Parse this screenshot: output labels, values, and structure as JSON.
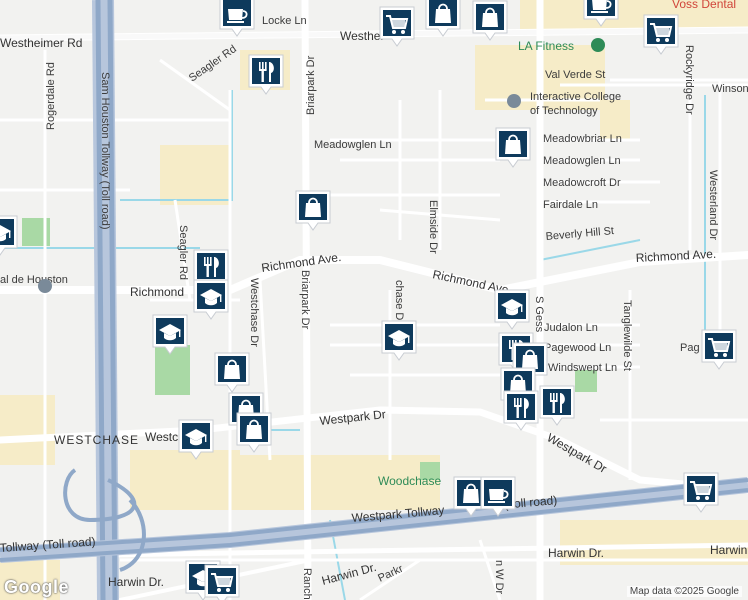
{
  "roads": {
    "locke": "Locke Ln",
    "westheimer_left": "Westheimer Rd",
    "westheimer_right": "Westhei",
    "rogerdale": "Rogerdale Rd",
    "seagler_top": "Seagler Rd",
    "seagler_left": "Seagler Rd",
    "sam_houston": "Sam Houston Tollway (Toll road)",
    "briarpark_top": "Briarpark Dr",
    "briarpark_bottom": "Briarpark Dr",
    "meadowglen_left": "Meadowglen Ln",
    "meadowbriar": "Meadowbriar Ln",
    "meadowglen_right": "Meadowglen Ln",
    "meadowcroft": "Meadowcroft Dr",
    "fairdale": "Fairdale Ln",
    "elmside": "Elmside Dr",
    "beverly_hill": "Beverly Hill St",
    "richmond_left": "Richmond Ave.",
    "richmond_mid": "Richmond Ave",
    "richmond_right": "Richmond Ave.",
    "richmond_far_left": "Richmond",
    "val_verde": "Val Verde St",
    "winsor": "Winson",
    "rockyridge": "Rockyridge Dr",
    "westerland": "Westerland Dr",
    "westchase_dr": "Westchase Dr",
    "westchase_dr2": "chase Dr",
    "judalon": "Judalon Ln",
    "pagewood": "Pagewood Ln",
    "pagewood2": "Pag",
    "windswept": "Windswept Ln",
    "tanglewilde": "Tanglewilde St",
    "s_gessner": "S Gess",
    "westpark_left": "Westpark Dr",
    "westpark_right": "Westpark Dr",
    "westchase_area": "WESTCHASE",
    "westchase_area2": "Westc",
    "westpark_tollway": "Westpark Tollway",
    "westpark_tollway_suffix": "(Toll road)",
    "tollway_left": "Tollway (Toll road)",
    "harwin_left": "Harwin Dr.",
    "harwin_mid": "Harwin Dr.",
    "harwin_right": "Harwin Dr.",
    "harwin_far_right": "Harwin",
    "ranch": "Ranch",
    "parkr": "Parkr",
    "n_w_dr": "n W Dr",
    "de_houston": "al de\nHouston"
  },
  "pois": {
    "la_fitness": "LA Fitness",
    "interactive_college": "Interactive College",
    "interactive_college_2": "of Technology",
    "woodchase": "Woodchase",
    "voss_dental": "Voss Dental"
  },
  "footer": {
    "logo": "Google",
    "credit": "Map data ©2025 Google"
  },
  "colors": {
    "marker_fill": "#ffffff",
    "marker_icon": "#0e3a5c",
    "highway": "#8fa8c8",
    "freeway_light": "#b7c6dc",
    "water": "#9ad8e8",
    "park": "#a9d9a5",
    "commercial": "#f6ecc8"
  },
  "markers": [
    {
      "type": "cafe-icon"
    },
    {
      "type": "cart-icon"
    },
    {
      "type": "shopping-bag-icon"
    },
    {
      "type": "shopping-bag-icon"
    },
    {
      "type": "cafe-icon"
    },
    {
      "type": "cart-icon"
    },
    {
      "type": "restaurant-icon"
    },
    {
      "type": "shopping-bag-icon"
    },
    {
      "type": "shopping-bag-icon"
    },
    {
      "type": "school-icon"
    },
    {
      "type": "restaurant-icon"
    },
    {
      "type": "school-icon"
    },
    {
      "type": "school-icon"
    },
    {
      "type": "school-icon"
    },
    {
      "type": "school-icon"
    },
    {
      "type": "cart-icon"
    },
    {
      "type": "restaurant-icon"
    },
    {
      "type": "shopping-bag-icon"
    },
    {
      "type": "shopping-bag-icon"
    },
    {
      "type": "shopping-bag-icon"
    },
    {
      "type": "restaurant-icon"
    },
    {
      "type": "restaurant-icon"
    },
    {
      "type": "school-icon"
    },
    {
      "type": "shopping-bag-icon"
    },
    {
      "type": "shopping-bag-icon"
    },
    {
      "type": "cart-icon"
    },
    {
      "type": "shopping-bag-icon"
    },
    {
      "type": "cafe-icon"
    },
    {
      "type": "school-icon"
    },
    {
      "type": "cart-icon"
    }
  ]
}
